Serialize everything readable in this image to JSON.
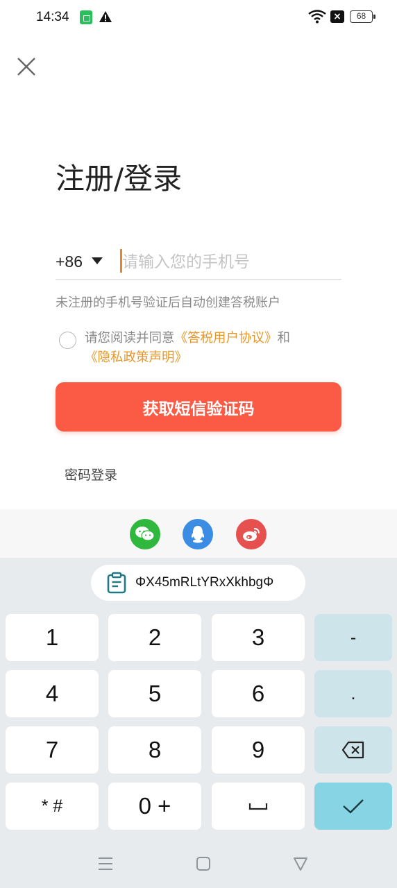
{
  "status_bar": {
    "time": "14:34",
    "battery": "68",
    "icons": [
      "app-icon",
      "warning-icon",
      "wifi-icon",
      "close-icon",
      "battery-icon"
    ]
  },
  "header": {
    "title": "注册/登录"
  },
  "login_form": {
    "country_code": "+86",
    "phone_placeholder": "请输入您的手机号",
    "hint": "未注册的手机号验证后自动创建答税账户",
    "agreement": {
      "prefix": "请您阅读并同意",
      "user_agreement": "《答税用户协议》",
      "conjunction": "和",
      "privacy_policy": "《隐私政策声明》"
    },
    "sms_button": "获取短信验证码",
    "password_login": "密码登录"
  },
  "social_login": [
    "wechat-icon",
    "qq-icon",
    "weibo-icon"
  ],
  "keyboard": {
    "clipboard": "ΦX45mRLtYRxXkhbgΦ",
    "keys": {
      "k1": "1",
      "k2": "2",
      "k3": "3",
      "k_dash": "-",
      "k4": "4",
      "k5": "5",
      "k6": "6",
      "k_dot": ".",
      "k7": "7",
      "k8": "8",
      "k9": "9",
      "k_star": "* #",
      "k0": "0 +"
    }
  },
  "colors": {
    "primary": "#fb5a45",
    "link": "#e8982a",
    "confirm_key": "#86d4e4",
    "side_key": "#cde4ea"
  }
}
